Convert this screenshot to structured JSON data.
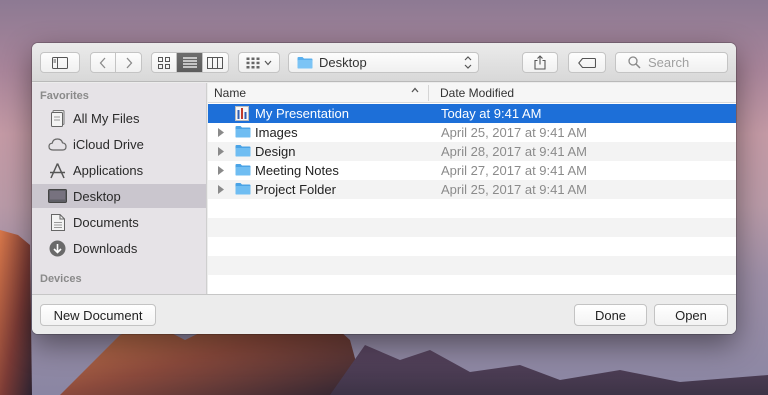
{
  "toolbar": {
    "view_modes": [
      {
        "icon": "icon-view-icon",
        "active": false
      },
      {
        "icon": "list-view-icon",
        "active": true
      },
      {
        "icon": "column-view-icon",
        "active": false
      }
    ],
    "location": {
      "icon": "folder-icon",
      "label": "Desktop"
    },
    "search": {
      "placeholder": "Search",
      "icon": "magnifier-icon"
    }
  },
  "sidebar": {
    "sections": [
      {
        "header": "Favorites",
        "items": [
          {
            "label": "All My Files",
            "icon": "all-files-icon",
            "selected": false
          },
          {
            "label": "iCloud Drive",
            "icon": "cloud-icon",
            "selected": false
          },
          {
            "label": "Applications",
            "icon": "applications-icon",
            "selected": false
          },
          {
            "label": "Desktop",
            "icon": "desktop-icon",
            "selected": true
          },
          {
            "label": "Documents",
            "icon": "document-icon",
            "selected": false
          },
          {
            "label": "Downloads",
            "icon": "download-icon",
            "selected": false
          }
        ]
      },
      {
        "header": "Devices",
        "items": []
      }
    ]
  },
  "file_list": {
    "columns": [
      {
        "label": "Name",
        "sort": "ascending"
      },
      {
        "label": "Date Modified"
      }
    ],
    "rows": [
      {
        "name": "My Presentation",
        "date": "Today at 9:41 AM",
        "icon": "presentation-file-icon",
        "expandable": false,
        "selected": true
      },
      {
        "name": "Images",
        "date": "April 25, 2017 at 9:41 AM",
        "icon": "folder-icon",
        "expandable": true,
        "selected": false
      },
      {
        "name": "Design",
        "date": "April 28, 2017 at 9:41 AM",
        "icon": "folder-icon",
        "expandable": true,
        "selected": false
      },
      {
        "name": "Meeting Notes",
        "date": "April 27, 2017 at 9:41 AM",
        "icon": "folder-icon",
        "expandable": true,
        "selected": false
      },
      {
        "name": "Project Folder",
        "date": "April 25, 2017 at 9:41 AM",
        "icon": "folder-icon",
        "expandable": true,
        "selected": false
      }
    ]
  },
  "footer": {
    "new_document_label": "New Document",
    "done_label": "Done",
    "open_label": "Open"
  },
  "colors": {
    "selection": "#1d6fd8",
    "sidebar_selected": "#cac6ce",
    "folder": "#5ab0ee"
  }
}
